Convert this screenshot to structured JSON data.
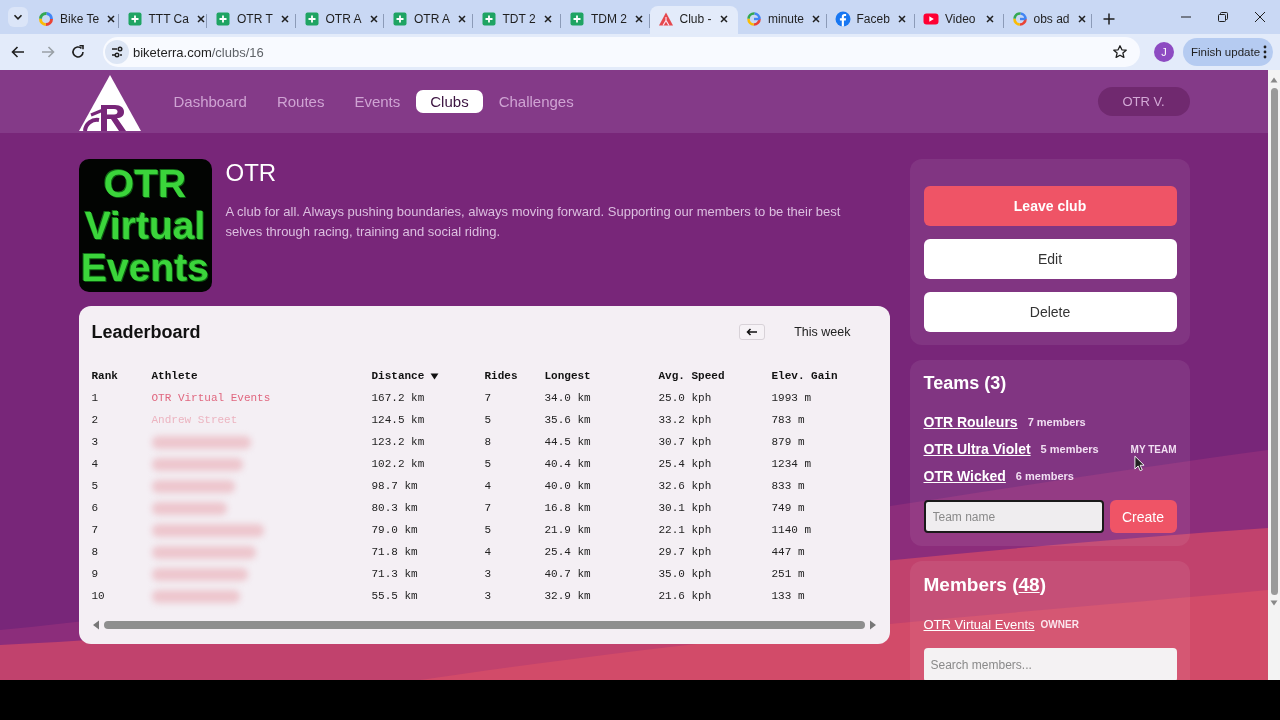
{
  "browser": {
    "tabs": [
      {
        "title": "Bike Te",
        "kind": "ring",
        "selected": false
      },
      {
        "title": "TTT Ca",
        "kind": "sheet",
        "selected": false
      },
      {
        "title": "OTR T",
        "kind": "sheet",
        "selected": false
      },
      {
        "title": "OTR A",
        "kind": "sheet",
        "selected": false
      },
      {
        "title": "OTR A",
        "kind": "sheet",
        "selected": false
      },
      {
        "title": "TDT 2",
        "kind": "sheet",
        "selected": false
      },
      {
        "title": "TDM 2",
        "kind": "sheet",
        "selected": false
      },
      {
        "title": "Club -",
        "kind": "mountain",
        "selected": true
      },
      {
        "title": "minute",
        "kind": "glogo",
        "selected": false
      },
      {
        "title": "Faceb",
        "kind": "flogo",
        "selected": false
      },
      {
        "title": "Video",
        "kind": "play",
        "selected": false
      },
      {
        "title": "obs ad",
        "kind": "glogo",
        "selected": false
      }
    ],
    "address": {
      "host": "biketerra.com",
      "path": "/clubs/16"
    },
    "profile_initial": "J",
    "update_button": "Finish update"
  },
  "nav": {
    "links": [
      {
        "label": "Dashboard",
        "selected": false
      },
      {
        "label": "Routes",
        "selected": false
      },
      {
        "label": "Events",
        "selected": false
      },
      {
        "label": "Clubs",
        "selected": true
      },
      {
        "label": "Challenges",
        "selected": false
      }
    ],
    "user": "OTR V."
  },
  "club": {
    "logo_lines": [
      "OTR",
      "Virtual",
      "Events"
    ],
    "name": "OTR",
    "description": "A club for all. Always pushing boundaries, always moving forward. Supporting our members to be their best selves through racing, training and social riding."
  },
  "leaderboard": {
    "title": "Leaderboard",
    "period": "This week",
    "columns": [
      {
        "label": "Rank",
        "sorted": false
      },
      {
        "label": "Athlete",
        "sorted": false
      },
      {
        "label": "Distance",
        "sorted": true
      },
      {
        "label": "Rides",
        "sorted": false
      },
      {
        "label": "Longest",
        "sorted": false
      },
      {
        "label": "Avg. Speed",
        "sorted": false
      },
      {
        "label": "Elev. Gain",
        "sorted": false
      }
    ],
    "rows": [
      {
        "rank": "1",
        "athlete": "OTR Virtual Events",
        "obscured": false,
        "stats": [
          "167.2 km",
          "7",
          "34.0 km",
          "25.0 kph",
          "1993 m"
        ]
      },
      {
        "rank": "2",
        "athlete": "Andrew Street",
        "obscured": true,
        "stats": [
          "124.5 km",
          "5",
          "35.6 km",
          "33.2 kph",
          "783 m"
        ]
      },
      {
        "rank": "3",
        "obscured": true,
        "stats": [
          "123.2 km",
          "8",
          "44.5 km",
          "30.7 kph",
          "879 m"
        ]
      },
      {
        "rank": "4",
        "obscured": true,
        "stats": [
          "102.2 km",
          "5",
          "40.4 km",
          "25.4 kph",
          "1234 m"
        ]
      },
      {
        "rank": "5",
        "obscured": true,
        "stats": [
          "98.7 km",
          "4",
          "40.0 km",
          "32.6 kph",
          "833 m"
        ]
      },
      {
        "rank": "6",
        "obscured": true,
        "stats": [
          "80.3 km",
          "7",
          "16.8 km",
          "30.1 kph",
          "749 m"
        ]
      },
      {
        "rank": "7",
        "obscured": true,
        "stats": [
          "79.0 km",
          "5",
          "21.9 km",
          "22.1 kph",
          "1140 m"
        ]
      },
      {
        "rank": "8",
        "obscured": true,
        "stats": [
          "71.8 km",
          "4",
          "25.4 km",
          "29.7 kph",
          "447 m"
        ]
      },
      {
        "rank": "9",
        "obscured": true,
        "stats": [
          "71.3 km",
          "3",
          "40.7 km",
          "35.0 kph",
          "251 m"
        ]
      },
      {
        "rank": "10",
        "obscured": true,
        "stats": [
          "55.5 km",
          "3",
          "32.9 km",
          "21.6 kph",
          "133 m"
        ]
      }
    ]
  },
  "actions": [
    {
      "label": "Leave club",
      "kind": "danger"
    },
    {
      "label": "Edit",
      "kind": "plain"
    },
    {
      "label": "Delete",
      "kind": "plain"
    }
  ],
  "teams": {
    "title": "Teams (3)",
    "items": [
      {
        "name": "OTR Rouleurs",
        "members": "7 members"
      },
      {
        "name": "OTR Ultra Violet",
        "members": "5 members",
        "tag": "MY TEAM"
      },
      {
        "name": "OTR Wicked",
        "members": "6 members"
      }
    ],
    "input": {
      "placeholder": "Team name",
      "focused": true
    },
    "create_button": "Create"
  },
  "members": {
    "title_before": "Members (",
    "count": "48",
    "title_after": ")",
    "items": [
      {
        "name": "OTR Virtual Events",
        "role": "OWNER"
      }
    ],
    "search": {
      "placeholder": "Search members..."
    }
  }
}
